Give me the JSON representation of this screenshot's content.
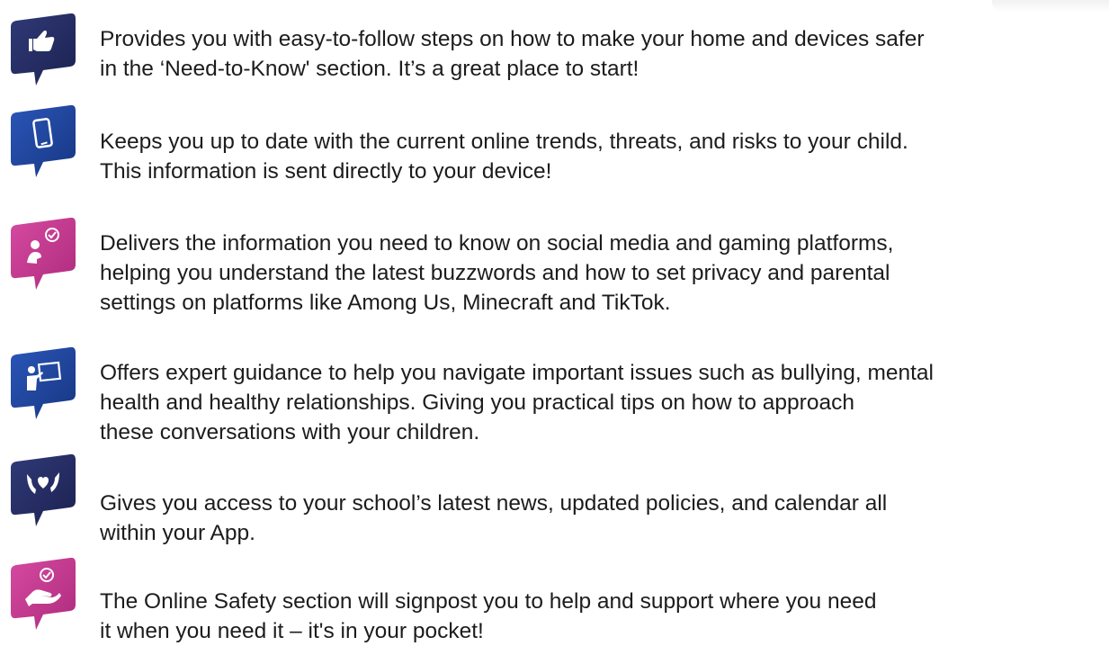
{
  "colors": {
    "navy": "#232a5e",
    "blue": "#1d3f95",
    "pink": "#c5378f",
    "text": "#1c1c1c"
  },
  "features": [
    {
      "icon": "thumbs-up-icon",
      "text": "Provides you with easy-to-follow steps on how to make your home and devices safer\nin the ‘Need-to-Know' section. It’s a great place to start!"
    },
    {
      "icon": "smartphone-icon",
      "text": "Keeps you up to date with the current online trends, threats, and risks to your child.\nThis information is sent directly to your device!"
    },
    {
      "icon": "verified-user-icon",
      "text": "Delivers the information you need to know on social media and gaming platforms,\nhelping you understand the latest buzzwords and how to set privacy and parental\nsettings on platforms like Among Us, Minecraft and TikTok."
    },
    {
      "icon": "presenter-icon",
      "text": "Offers expert guidance to help you navigate important issues such as bullying, mental\nhealth and healthy relationships. Giving you practical tips on how to approach\nthese conversations with your children."
    },
    {
      "icon": "hands-heart-icon",
      "text": "Gives you access to your school’s latest news, updated policies, and calendar all\nwithin your App."
    },
    {
      "icon": "helping-hand-icon",
      "text": "The Online Safety section will signpost you to help and support where you need\nit when you need it – it's in your pocket!"
    }
  ]
}
